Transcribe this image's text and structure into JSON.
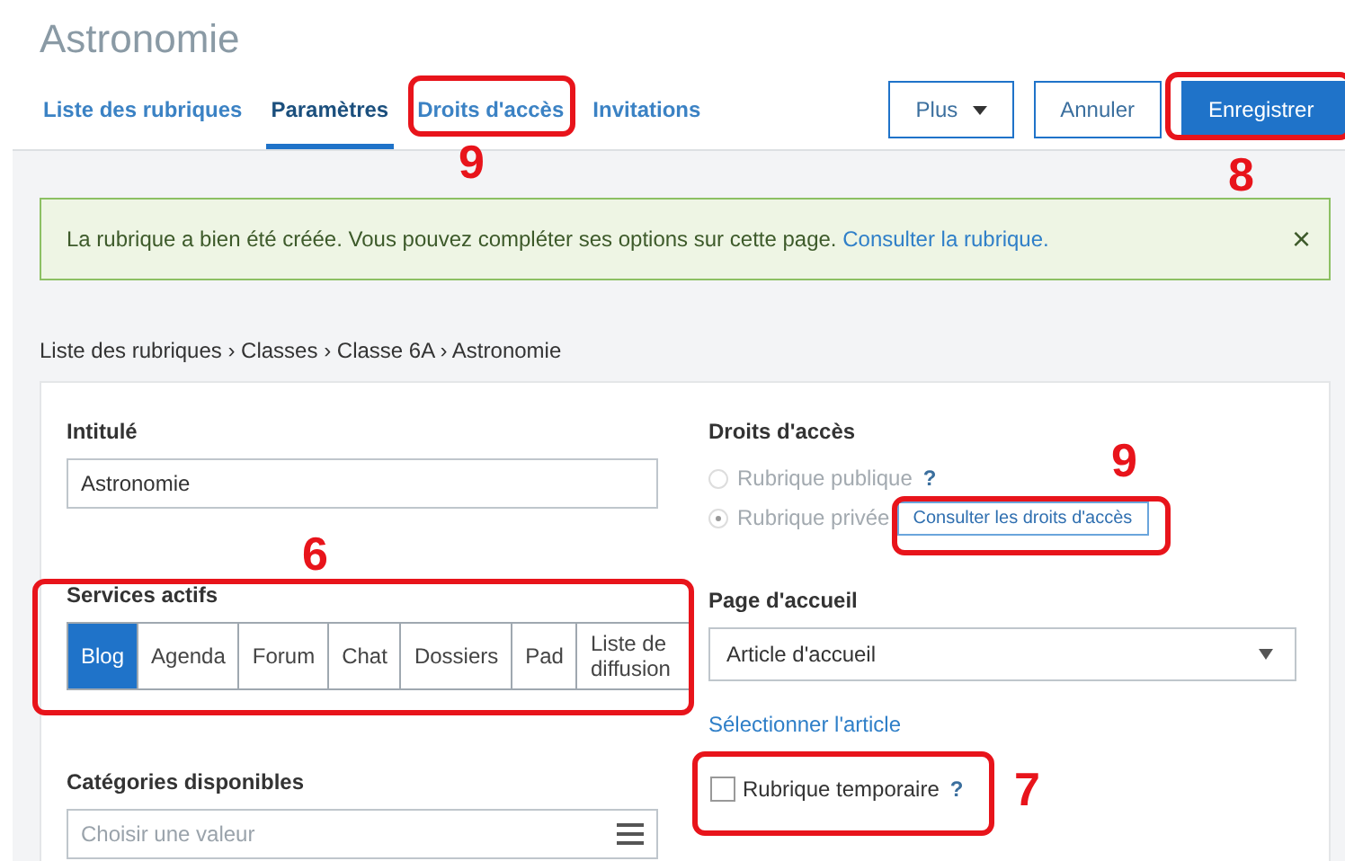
{
  "page": {
    "title": "Astronomie"
  },
  "tabs": [
    {
      "label": "Liste des rubriques",
      "selected": false
    },
    {
      "label": "Paramètres",
      "selected": true
    },
    {
      "label": "Droits d'accès",
      "selected": false
    },
    {
      "label": "Invitations",
      "selected": false
    }
  ],
  "actions": [
    {
      "label": "Plus",
      "kind": "dropdown"
    },
    {
      "label": "Annuler",
      "kind": "secondary"
    },
    {
      "label": "Enregistrer",
      "kind": "primary"
    }
  ],
  "alert": {
    "message": "La rubrique a bien été créée. Vous pouvez compléter ses options sur cette page.",
    "link": "Consulter la rubrique.",
    "close": "×"
  },
  "breadcrumb": "Liste des rubriques › Classes › Classe 6A › Astronomie",
  "form": {
    "title_field": {
      "label": "Intitulé",
      "value": "Astronomie"
    },
    "services": {
      "label": "Services actifs",
      "items": [
        {
          "label": "Blog",
          "selected": true
        },
        {
          "label": "Agenda",
          "selected": false
        },
        {
          "label": "Forum",
          "selected": false
        },
        {
          "label": "Chat",
          "selected": false
        },
        {
          "label": "Dossiers",
          "selected": false
        },
        {
          "label": "Pad",
          "selected": false
        },
        {
          "label": "Liste de diffusion",
          "selected": false
        }
      ]
    },
    "categories": {
      "label": "Catégories disponibles",
      "placeholder": "Choisir une valeur"
    },
    "access": {
      "label": "Droits d'accès",
      "options": [
        {
          "label": "Rubrique publique",
          "selected": false,
          "disabled": true,
          "help": "?"
        },
        {
          "label": "Rubrique privée",
          "selected": true,
          "disabled": true
        }
      ],
      "button": "Consulter les droits d'accès"
    },
    "home_page": {
      "label": "Page d'accueil",
      "value": "Article d'accueil",
      "link": "Sélectionner l'article"
    },
    "temporary": {
      "label": "Rubrique temporaire",
      "checked": false,
      "help": "?"
    }
  },
  "annotations": [
    {
      "number": "9"
    },
    {
      "number": "8"
    },
    {
      "number": "6"
    },
    {
      "number": "9"
    },
    {
      "number": "7"
    }
  ]
}
